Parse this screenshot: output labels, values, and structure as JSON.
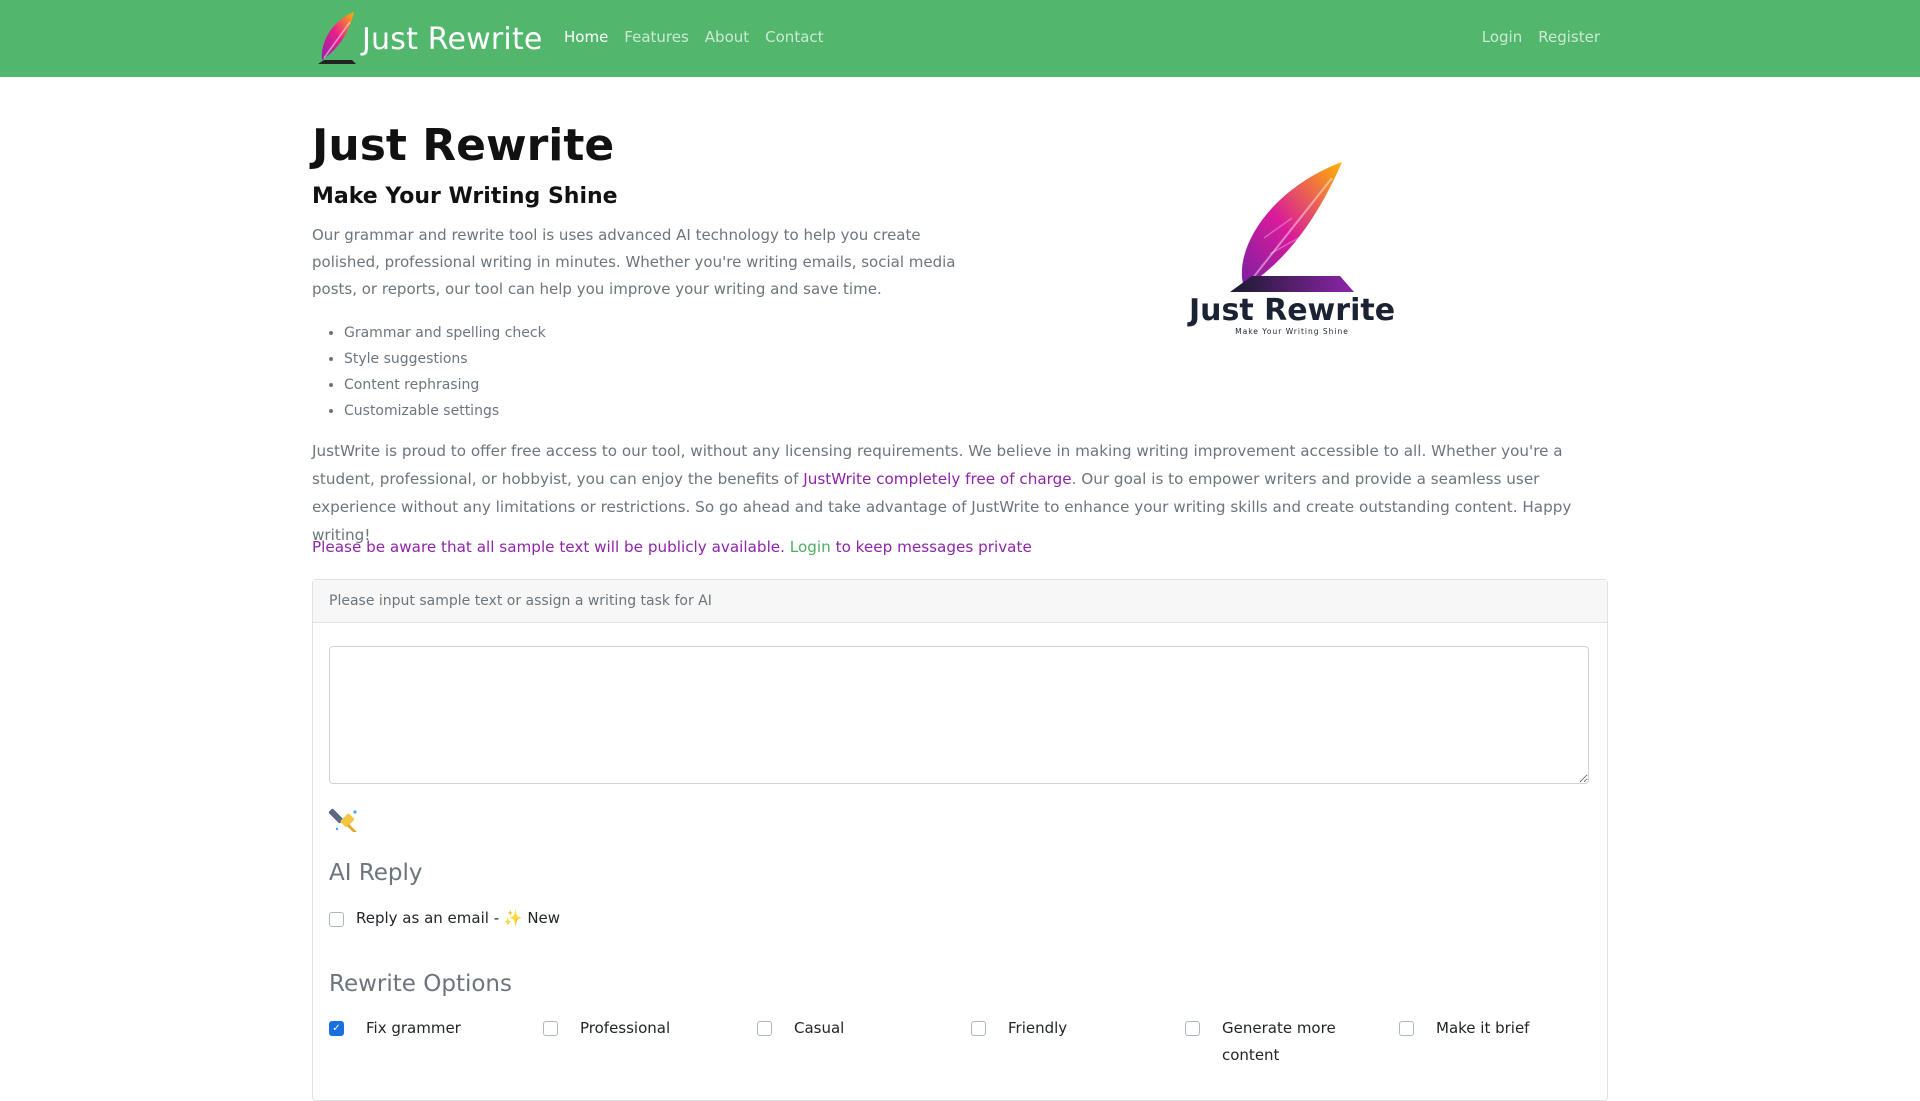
{
  "navbar": {
    "brand": "Just Rewrite",
    "links": [
      "Home",
      "Features",
      "About",
      "Contact"
    ],
    "right_links": [
      "Login",
      "Register"
    ],
    "bg_color": "#52b76d"
  },
  "hero": {
    "title": "Just Rewrite",
    "subtitle": "Make Your Writing Shine",
    "description": "Our grammar and rewrite tool is uses advanced AI technology to help you create polished, professional writing in minutes. Whether you're writing emails, social media posts, or reports, our tool can help you improve your writing and save time.",
    "features": [
      "Grammar and spelling check",
      "Style suggestions",
      "Content rephrasing",
      "Customizable settings"
    ],
    "logo_title": "Just Rewrite",
    "logo_tagline": "Make Your Writing Shine"
  },
  "about": {
    "text_before": "JustWrite is proud to offer free access to our tool, without any licensing requirements. We believe in making writing improvement accessible to all. Whether you're a student, professional, or hobbyist, you can enjoy the benefits of ",
    "highlight": "JustWrite completely free of charge",
    "text_after": ". Our goal is to empower writers and provide a seamless user experience without any limitations or restrictions. So go ahead and take advantage of JustWrite to enhance your writing skills and create outstanding content. Happy writing!"
  },
  "notice": {
    "before": "Please be aware that all sample text will be publicly available. ",
    "link": "Login",
    "after": " to keep messages private"
  },
  "form": {
    "header": "Please input sample text or assign a writing task for AI",
    "textarea_value": "",
    "ai_reply_title": "AI Reply",
    "reply_email_label": "Reply as an email - ✨ New",
    "reply_email_checked": false,
    "rewrite_title": "Rewrite Options",
    "options": [
      {
        "label": "Fix grammer",
        "checked": true
      },
      {
        "label": "Professional",
        "checked": false
      },
      {
        "label": "Casual",
        "checked": false
      },
      {
        "label": "Friendly",
        "checked": false
      },
      {
        "label": "Generate more content",
        "checked": false
      },
      {
        "label": "Make it brief",
        "checked": false
      }
    ]
  }
}
